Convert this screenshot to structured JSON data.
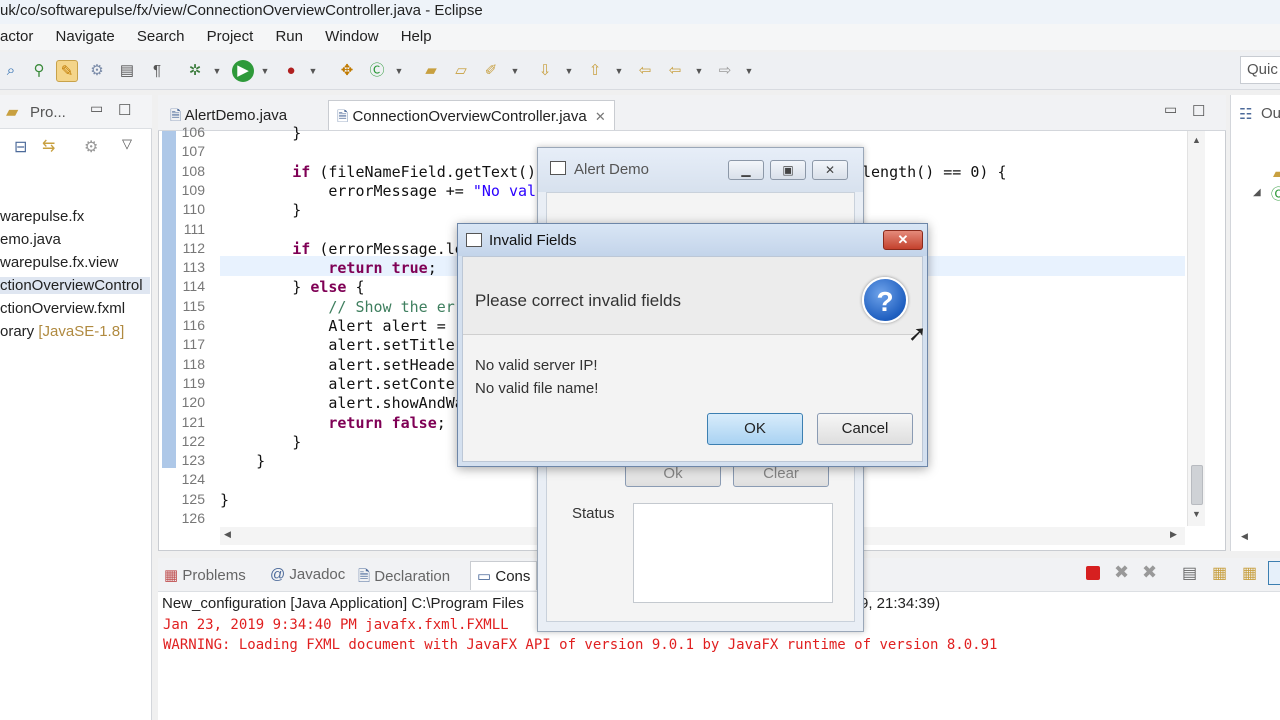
{
  "window": {
    "title": "uk/co/softwarepulse/fx/view/ConnectionOverviewController.java - Eclipse"
  },
  "menu": [
    "actor",
    "Navigate",
    "Search",
    "Project",
    "Run",
    "Window",
    "Help"
  ],
  "quick_access": "Quic",
  "package_explorer": {
    "tab_label": "Pro...",
    "items": [
      {
        "label": "warepulse.fx"
      },
      {
        "label": "emo.java"
      },
      {
        "label": "warepulse.fx.view"
      },
      {
        "label": "ctionOverviewControl"
      },
      {
        "label": "ctionOverview.fxml"
      },
      {
        "label": "orary",
        "suffix": "[JavaSE-1.8]"
      }
    ]
  },
  "editor": {
    "tabs": [
      {
        "label": "AlertDemo.java",
        "active": false
      },
      {
        "label": "ConnectionOverviewController.java",
        "active": true
      }
    ],
    "lines": [
      {
        "n": "106",
        "text": "        }"
      },
      {
        "n": "107",
        "text": ""
      },
      {
        "n": "108",
        "text": "        if (fileNameField.getText()",
        "tail": "length() == 0) {"
      },
      {
        "n": "109",
        "text": "            errorMessage += \"No val"
      },
      {
        "n": "110",
        "text": "        }"
      },
      {
        "n": "111",
        "text": ""
      },
      {
        "n": "112",
        "text": "        if (errorMessage.le"
      },
      {
        "n": "113",
        "text": "            return true;"
      },
      {
        "n": "114",
        "text": "        } else {"
      },
      {
        "n": "115",
        "text": "            // Show the er"
      },
      {
        "n": "116",
        "text": "            Alert alert = ("
      },
      {
        "n": "117",
        "text": "            alert.setTitle"
      },
      {
        "n": "118",
        "text": "            alert.setHeade"
      },
      {
        "n": "119",
        "text": "            alert.setConte"
      },
      {
        "n": "120",
        "text": "            alert.showAndWa"
      },
      {
        "n": "121",
        "text": "            return false;"
      },
      {
        "n": "122",
        "text": "        }"
      },
      {
        "n": "123",
        "text": "    }"
      },
      {
        "n": "124",
        "text": ""
      },
      {
        "n": "125",
        "text": "}"
      },
      {
        "n": "126",
        "text": ""
      }
    ]
  },
  "outline": {
    "tab_label": "Ou"
  },
  "console": {
    "tabs": [
      "Problems",
      "Javadoc",
      "Declaration",
      "Cons"
    ],
    "launch_line": "New_configuration [Java Application] C:\\Program Files",
    "launch_line_tail": "9, 21:34:39)",
    "output": [
      "Jan 23, 2019 9:34:40 PM javafx.fxml.FXMLL",
      "WARNING: Loading FXML document with JavaFX API of version 9.0.1 by JavaFX runtime of version 8.0.91"
    ]
  },
  "alert_demo": {
    "title": "Alert Demo",
    "ok_label": "Ok",
    "clear_label": "Clear",
    "status_label": "Status"
  },
  "dialog": {
    "title": "Invalid Fields",
    "header": "Please correct invalid fields",
    "content_lines": [
      "No valid server IP!",
      "No valid file name!"
    ],
    "ok_label": "OK",
    "cancel_label": "Cancel",
    "close_glyph": "✕",
    "question_glyph": "?"
  },
  "colors": {
    "accent": "#3c7fb1",
    "console_error": "#e02020",
    "keyword": "#7f0055",
    "string": "#2a00ff",
    "comment": "#3f7f5f"
  }
}
